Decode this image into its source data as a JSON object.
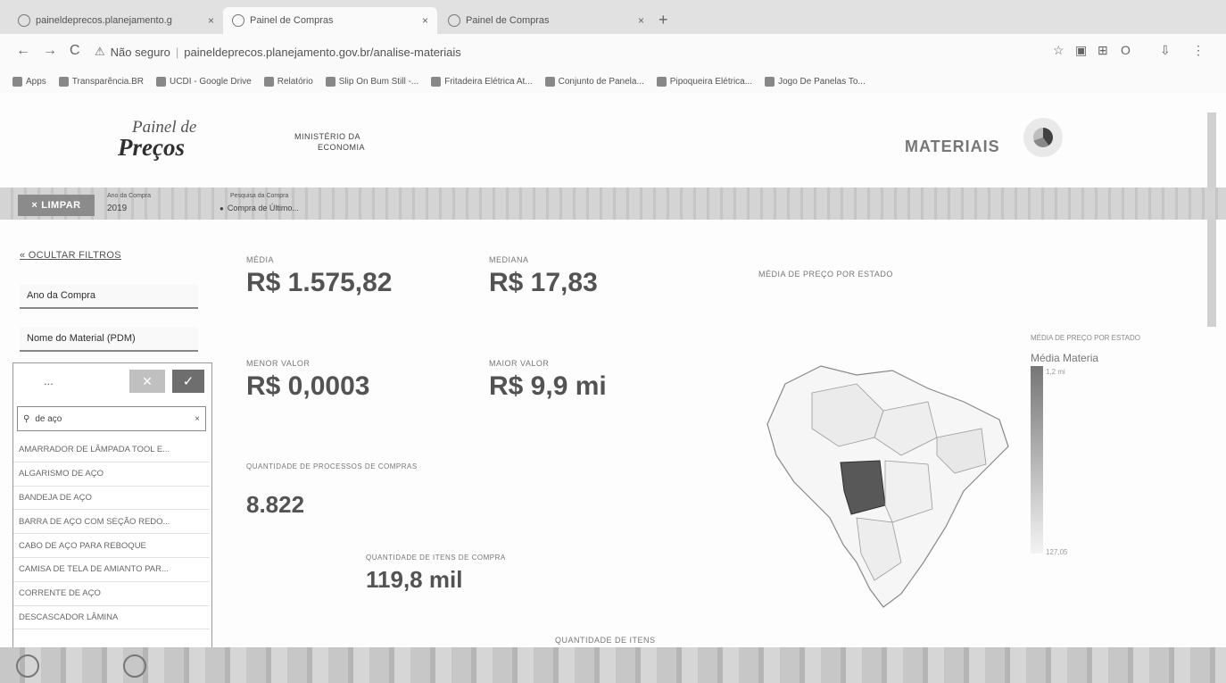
{
  "browser": {
    "tabs": [
      {
        "title": "paineldeprecos.planejamento.g"
      },
      {
        "title": "Painel de Compras"
      },
      {
        "title": "Painel de Compras"
      }
    ],
    "security": "Não seguro",
    "url": "paineldeprecos.planejamento.gov.br/analise-materiais",
    "bookmarks": [
      "Apps",
      "Transparência.BR",
      "UCDI - Google Drive",
      "Relatório",
      "Slip On Bum Still -...",
      "Fritadeira Elétrica At...",
      "Conjunto de Panela...",
      "Pipoqueira Elétrica...",
      "Jogo De Panelas To..."
    ]
  },
  "header": {
    "logo_line1": "Painel de",
    "logo_line2": "Preços",
    "ministry_line1": "MINISTÉRIO DA",
    "ministry_line2": "ECONOMIA",
    "module": "MATERIAIS"
  },
  "filterbar": {
    "clear_label": "LIMPAR",
    "selection1": {
      "label": "Ano da Compra",
      "value": "2019"
    },
    "selection2": {
      "label": "Pesquisa da Compra",
      "value": "Compra de Último..."
    }
  },
  "filters": {
    "hide_label": "OCULTAR FILTROS",
    "items": [
      "Ano da Compra",
      "Nome do Material (PDM)"
    ],
    "listbox": {
      "header": "...",
      "search_value": "de aço",
      "items": [
        "AMARRADOR DE LÂMPADA TOOL E...",
        "ALGARISMO DE AÇO",
        "BANDEJA DE AÇO",
        "BARRA DE AÇO COM SEÇÃO REDO...",
        "CABO DE AÇO PARA REBOQUE",
        "CAMISA DE TELA DE AMIANTO PAR...",
        "CORRENTE DE AÇO",
        "DESCASCADOR LÂMINA"
      ]
    }
  },
  "kpis": {
    "media": {
      "label": "MÉDIA",
      "value": "R$ 1.575,82"
    },
    "mediana": {
      "label": "MEDIANA",
      "value": "R$ 17,83"
    },
    "menor": {
      "label": "MENOR VALOR",
      "value": "R$ 0,0003"
    },
    "maior": {
      "label": "MAIOR VALOR",
      "value": "R$ 9,9 mi"
    },
    "processos": {
      "label": "QUANTIDADE DE PROCESSOS DE COMPRAS",
      "value": "8.822"
    },
    "itens": {
      "label": "QUANTIDADE DE ITENS DE COMPRA",
      "value": "119,8 mil"
    }
  },
  "map": {
    "title": "MÉDIA DE PREÇO POR ESTADO",
    "legend_title": "Média Materia",
    "legend_max": "1,2 mi",
    "legend_min": "127,05"
  },
  "bottom_label": "QUANTIDADE DE ITENS",
  "colors": {
    "primary_gray": "#8a8a8a",
    "map_highlight": "#555555"
  }
}
